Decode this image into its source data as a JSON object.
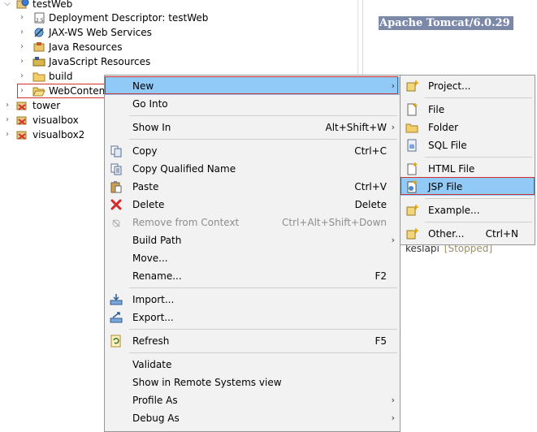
{
  "tree": {
    "items": [
      {
        "label": "testWeb",
        "icon": "web-project-icon",
        "expanded": true
      },
      {
        "label": "Deployment Descriptor: testWeb",
        "icon": "deployment-descriptor-icon"
      },
      {
        "label": "JAX-WS Web Services",
        "icon": "web-services-icon"
      },
      {
        "label": "Java Resources",
        "icon": "java-resources-icon"
      },
      {
        "label": "JavaScript Resources",
        "icon": "javascript-resources-icon"
      },
      {
        "label": "build",
        "icon": "folder-icon"
      },
      {
        "label": "WebContent",
        "icon": "folder-open-icon",
        "selected": true
      },
      {
        "label": "tower",
        "icon": "web-project-icon"
      },
      {
        "label": "visualbox",
        "icon": "web-project-icon"
      },
      {
        "label": "visualbox2",
        "icon": "web-project-icon"
      }
    ]
  },
  "server": {
    "banner": "Apache Tomcat/6.0.29",
    "entry_name": "keslapi",
    "entry_status": "[Stopped]"
  },
  "context_menu": {
    "items": [
      {
        "label": "New",
        "shortcut": "",
        "submenu": true,
        "highlighted": true
      },
      {
        "label": "Go Into",
        "shortcut": ""
      },
      {
        "label": "Show In",
        "shortcut": "Alt+Shift+W",
        "submenu": true
      },
      {
        "label": "Copy",
        "shortcut": "Ctrl+C",
        "icon": "copy-icon"
      },
      {
        "label": "Copy Qualified Name",
        "shortcut": "",
        "icon": "copy-qualified-icon"
      },
      {
        "label": "Paste",
        "shortcut": "Ctrl+V",
        "icon": "paste-icon"
      },
      {
        "label": "Delete",
        "shortcut": "Delete",
        "icon": "delete-icon"
      },
      {
        "label": "Remove from Context",
        "shortcut": "Ctrl+Alt+Shift+Down",
        "icon": "remove-context-icon",
        "disabled": true
      },
      {
        "label": "Build Path",
        "shortcut": "",
        "submenu": true
      },
      {
        "label": "Move...",
        "shortcut": ""
      },
      {
        "label": "Rename...",
        "shortcut": "F2"
      },
      {
        "label": "Import...",
        "shortcut": "",
        "icon": "import-icon"
      },
      {
        "label": "Export...",
        "shortcut": "",
        "icon": "export-icon"
      },
      {
        "label": "Refresh",
        "shortcut": "F5",
        "icon": "refresh-icon"
      },
      {
        "label": "Validate",
        "shortcut": ""
      },
      {
        "label": "Show in Remote Systems view",
        "shortcut": ""
      },
      {
        "label": "Profile As",
        "shortcut": "",
        "submenu": true
      },
      {
        "label": "Debug As",
        "shortcut": "",
        "submenu": true
      }
    ]
  },
  "new_submenu": {
    "items": [
      {
        "label": "Project...",
        "shortcut": "",
        "icon": "new-project-icon"
      },
      {
        "label": "File",
        "shortcut": "",
        "icon": "file-icon"
      },
      {
        "label": "Folder",
        "shortcut": "",
        "icon": "folder-icon"
      },
      {
        "label": "SQL File",
        "shortcut": "",
        "icon": "sql-file-icon"
      },
      {
        "label": "HTML File",
        "shortcut": "",
        "icon": "html-file-icon"
      },
      {
        "label": "JSP File",
        "shortcut": "",
        "icon": "jsp-file-icon",
        "highlighted": true
      },
      {
        "label": "Example...",
        "shortcut": "",
        "icon": "example-icon"
      },
      {
        "label": "Other...",
        "shortcut": "Ctrl+N",
        "icon": "other-icon"
      }
    ]
  },
  "colors": {
    "highlight": "#91c9f7",
    "annotation_red": "#d0312d",
    "menu_bg": "#f2f2f2",
    "banner_bg": "#7b88a8"
  }
}
